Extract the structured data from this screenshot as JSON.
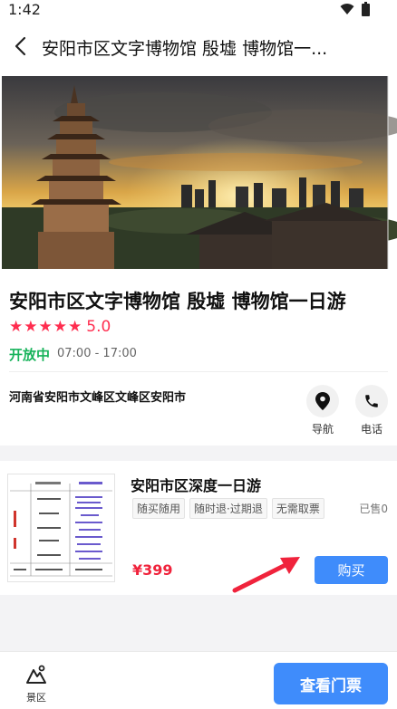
{
  "status_bar": {
    "time": "1:42"
  },
  "nav": {
    "title": "安阳市区文字博物馆 殷墟 博物馆一..."
  },
  "hero": {
    "image_alt": "pagoda-sunset-city"
  },
  "info": {
    "title": "安阳市区文字博物馆 殷墟 博物馆一日游",
    "rating": "5.0",
    "stars": 5,
    "open_status": "开放中",
    "hours": "07:00 - 17:00",
    "address": "河南省安阳市文峰区文峰区安阳市",
    "nav_label": "导航",
    "phone_label": "电话"
  },
  "product": {
    "title": "安阳市区深度一日游",
    "tags": [
      "随买随用",
      "随时退·过期退",
      "无需取票"
    ],
    "sold": "已售0",
    "price": "¥399",
    "buy_label": "购买"
  },
  "bottom": {
    "scenic_label": "景区",
    "view_tickets_label": "查看门票"
  },
  "colors": {
    "accent": "#3f8cfb",
    "price": "#f0233c",
    "star": "#ff2d4f",
    "open": "#18b35b"
  }
}
